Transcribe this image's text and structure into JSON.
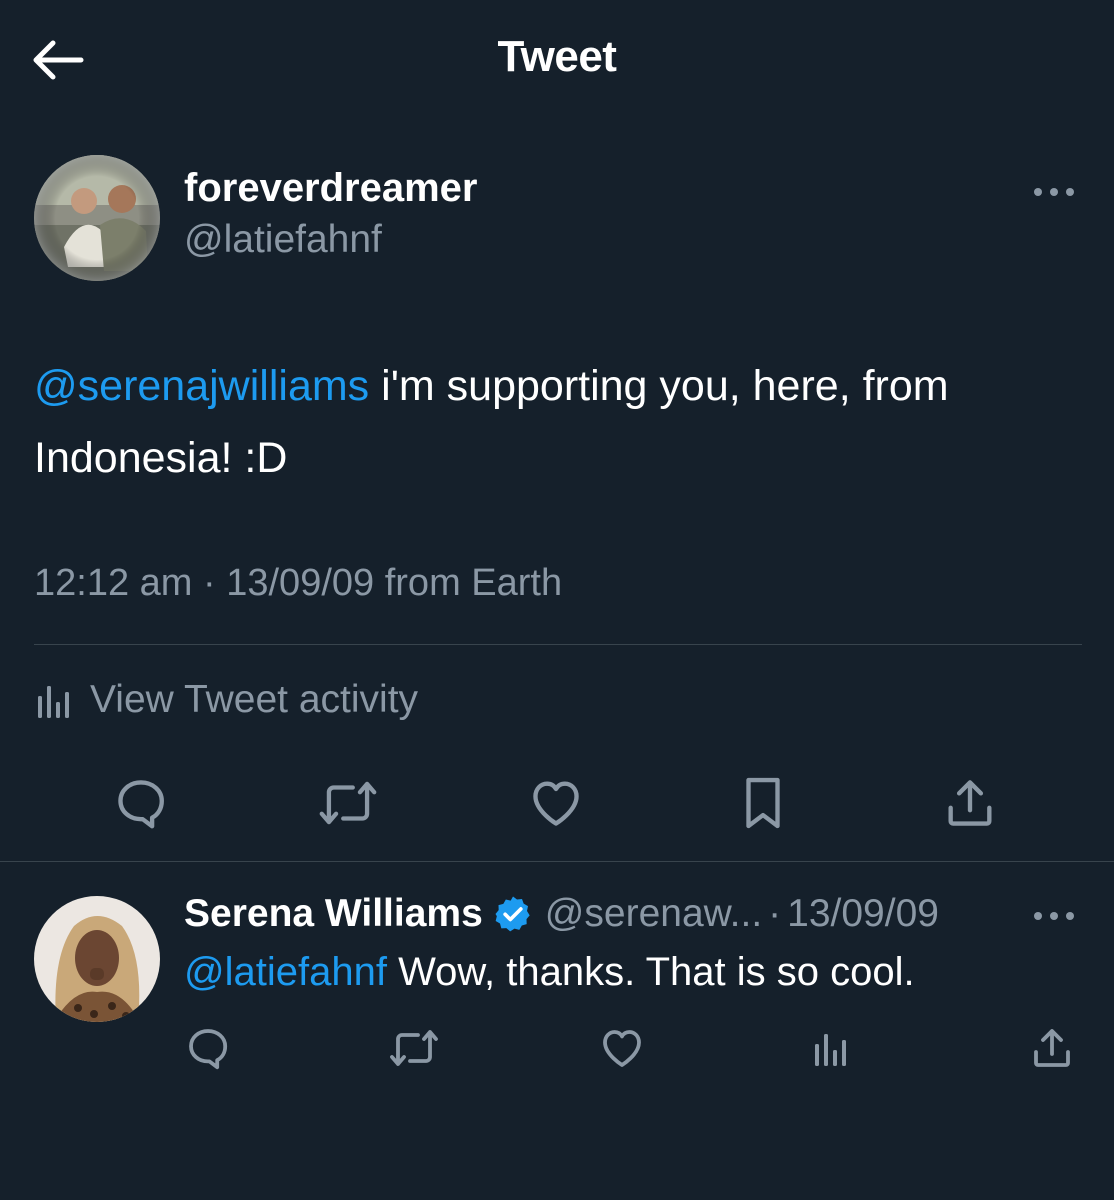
{
  "theme": {
    "background": "#15202b",
    "text": "#ffffff",
    "muted": "#8b98a5",
    "accent": "#1d9bf0",
    "divider": "#38444d"
  },
  "header": {
    "title": "Tweet",
    "back_icon": "arrow-left-icon"
  },
  "tweet": {
    "author": {
      "display_name": "foreverdreamer",
      "handle": "@latiefahnf"
    },
    "mention": "@serenajwilliams",
    "text": " i'm supporting you, here, from Indonesia! :D",
    "time": "12:12 am",
    "separator": "·",
    "date": "13/09/09",
    "source": "from Earth",
    "activity_label": "View Tweet activity",
    "actions": [
      "reply-icon",
      "retweet-icon",
      "like-icon",
      "bookmark-icon",
      "share-icon"
    ]
  },
  "reply": {
    "author": {
      "display_name": "Serena Williams",
      "handle": "@serenaw...",
      "verified": true
    },
    "separator": "·",
    "date": "13/09/09",
    "mention": "@latiefahnf",
    "text": " Wow, thanks. That is so cool.",
    "actions": [
      "reply-icon",
      "retweet-icon",
      "like-icon",
      "analytics-icon",
      "share-icon"
    ]
  }
}
